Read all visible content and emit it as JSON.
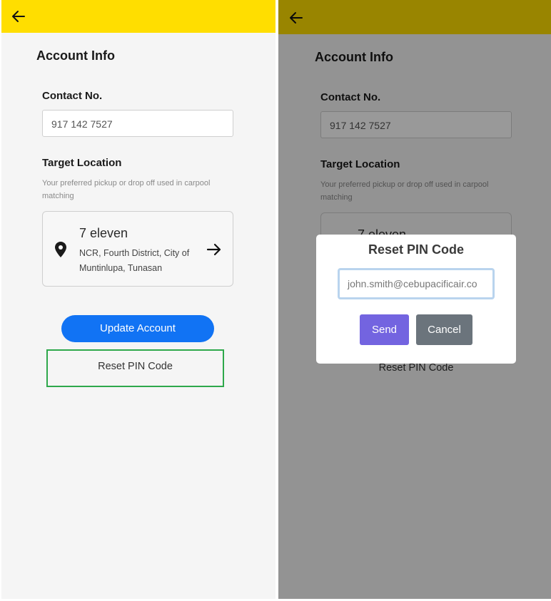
{
  "left_screen": {
    "page_title": "Account Info",
    "contact": {
      "label": "Contact No.",
      "value": "917 142 7527"
    },
    "target_location": {
      "label": "Target Location",
      "helper": "Your preferred pickup or drop off used in carpool matching",
      "name": "7 eleven",
      "address": "NCR, Fourth District, City of Muntinlupa, Tunasan"
    },
    "update_button": "Update Account",
    "reset_link": "Reset PIN Code"
  },
  "right_screen": {
    "page_title": "Account Info",
    "contact": {
      "label": "Contact No.",
      "value": "917 142 7527"
    },
    "target_location": {
      "label": "Target Location",
      "helper": "Your preferred pickup or drop off used in carpool matching",
      "name_partial": "7 eleven"
    },
    "reset_link": "Reset PIN Code",
    "modal": {
      "title": "Reset PIN Code",
      "email_value": "john.smith@cebupacificair.co",
      "send_label": "Send",
      "cancel_label": "Cancel"
    }
  },
  "icons": {
    "back": "arrow-left-icon",
    "location": "map-pin-icon",
    "next": "arrow-right-icon"
  },
  "colors": {
    "topbar": "#ffde00",
    "primary_button": "#1173f4",
    "send_button": "#7364e0",
    "cancel_button": "#6b747c",
    "highlight_border": "#2ea84b"
  }
}
